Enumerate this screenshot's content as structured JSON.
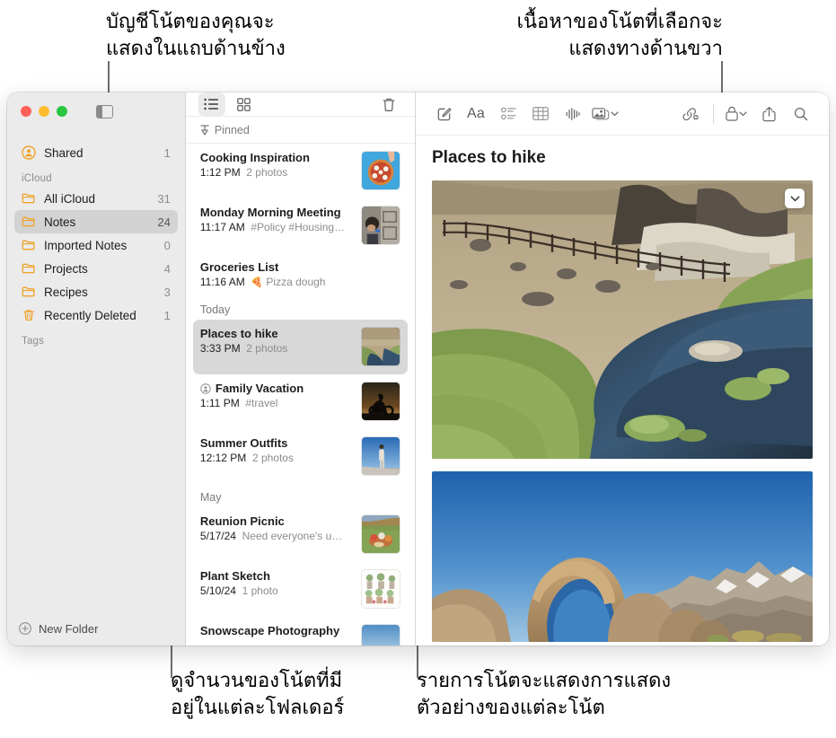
{
  "annotations": {
    "top_left": "บัญชีโน้ตของคุณจะ\nแสดงในแถบด้านข้าง",
    "top_right": "เนื้อหาของโน้ตที่เลือกจะ\nแสดงทางด้านขวา",
    "bottom_left": "ดูจำนวนของโน้ตที่มี\nอยู่ในแต่ละโฟลเดอร์",
    "bottom_right": "รายการโน้ตจะแสดงการแสดง\nตัวอย่างของแต่ละโน้ต"
  },
  "colors": {
    "folder_orange": "#f0a32a",
    "selection_gray": "#d3d3d3",
    "sidebar_bg": "#ebebeb",
    "accent_red": "#ff5f57",
    "accent_yellow": "#febc2e",
    "accent_green": "#28c840"
  },
  "window": {
    "traffic_lights": [
      "close-button",
      "minimize-button",
      "zoom-button"
    ],
    "sidebar_toggle": "sidebar-toggle-icon"
  },
  "sidebar": {
    "shared": {
      "label": "Shared",
      "count": "1",
      "icon": "shared-person-icon"
    },
    "sections": [
      {
        "header": "iCloud",
        "items": [
          {
            "label": "All iCloud",
            "count": "31",
            "icon": "folder-icon",
            "selected": false
          },
          {
            "label": "Notes",
            "count": "24",
            "icon": "folder-icon",
            "selected": true
          },
          {
            "label": "Imported Notes",
            "count": "0",
            "icon": "folder-icon",
            "selected": false
          },
          {
            "label": "Projects",
            "count": "4",
            "icon": "folder-icon",
            "selected": false
          },
          {
            "label": "Recipes",
            "count": "3",
            "icon": "folder-icon",
            "selected": false
          },
          {
            "label": "Recently Deleted",
            "count": "1",
            "icon": "trash-icon",
            "selected": false
          }
        ]
      },
      {
        "header": "Tags",
        "items": []
      }
    ],
    "new_folder": {
      "label": "New Folder",
      "icon": "plus-circle-icon"
    }
  },
  "notes_list": {
    "toolbar": {
      "list_view": "list-view-icon",
      "gallery_view": "gallery-view-icon",
      "delete": "trash-icon"
    },
    "groups": [
      {
        "title": "Pinned",
        "icon": "pin-icon",
        "notes": [
          {
            "title": "Cooking Inspiration",
            "time": "1:12 PM",
            "preview": "2 photos",
            "thumb": "pizza",
            "shared": false,
            "selected": false
          },
          {
            "title": "Monday Morning Meeting",
            "time": "11:17 AM",
            "preview": "#Policy #Housing…",
            "thumb": "meeting",
            "shared": false,
            "selected": false
          },
          {
            "title": "Groceries List",
            "time": "11:16 AM",
            "preview": "Pizza dough",
            "emoji": "🍕",
            "thumb": null,
            "shared": false,
            "selected": false
          }
        ]
      },
      {
        "title": "Today",
        "notes": [
          {
            "title": "Places to hike",
            "time": "3:33 PM",
            "preview": "2 photos",
            "thumb": "hike",
            "shared": false,
            "selected": true
          },
          {
            "title": "Family Vacation",
            "time": "1:11 PM",
            "preview": "#travel",
            "thumb": "bike",
            "shared": true,
            "selected": false
          },
          {
            "title": "Summer Outfits",
            "time": "12:12 PM",
            "preview": "2 photos",
            "thumb": "outfit",
            "shared": false,
            "selected": false
          }
        ]
      },
      {
        "title": "May",
        "notes": [
          {
            "title": "Reunion Picnic",
            "time": "5/17/24",
            "preview": "Need everyone's u…",
            "thumb": "picnic",
            "shared": false,
            "selected": false
          },
          {
            "title": "Plant Sketch",
            "time": "5/10/24",
            "preview": "1 photo",
            "thumb": "plants",
            "shared": false,
            "selected": false
          },
          {
            "title": "Snowscape Photography",
            "time": "",
            "preview": "",
            "thumb": "snow",
            "shared": false,
            "selected": false
          }
        ]
      }
    ]
  },
  "detail": {
    "toolbar": [
      {
        "name": "compose-note-icon"
      },
      {
        "name": "format-text-icon",
        "label": "Aa"
      },
      {
        "name": "checklist-icon"
      },
      {
        "name": "table-icon"
      },
      {
        "name": "audio-waveform-icon"
      },
      {
        "name": "media-icon",
        "chevron": true
      },
      {
        "name": "collaborate-link-icon"
      },
      {
        "name": "lock-icon",
        "chevron": true
      },
      {
        "name": "share-icon"
      },
      {
        "name": "search-icon"
      }
    ],
    "note_title": "Places to hike",
    "attachments": [
      {
        "name": "river-landscape-photo",
        "chevron": true
      },
      {
        "name": "rock-arch-photo",
        "chevron": false
      }
    ]
  }
}
